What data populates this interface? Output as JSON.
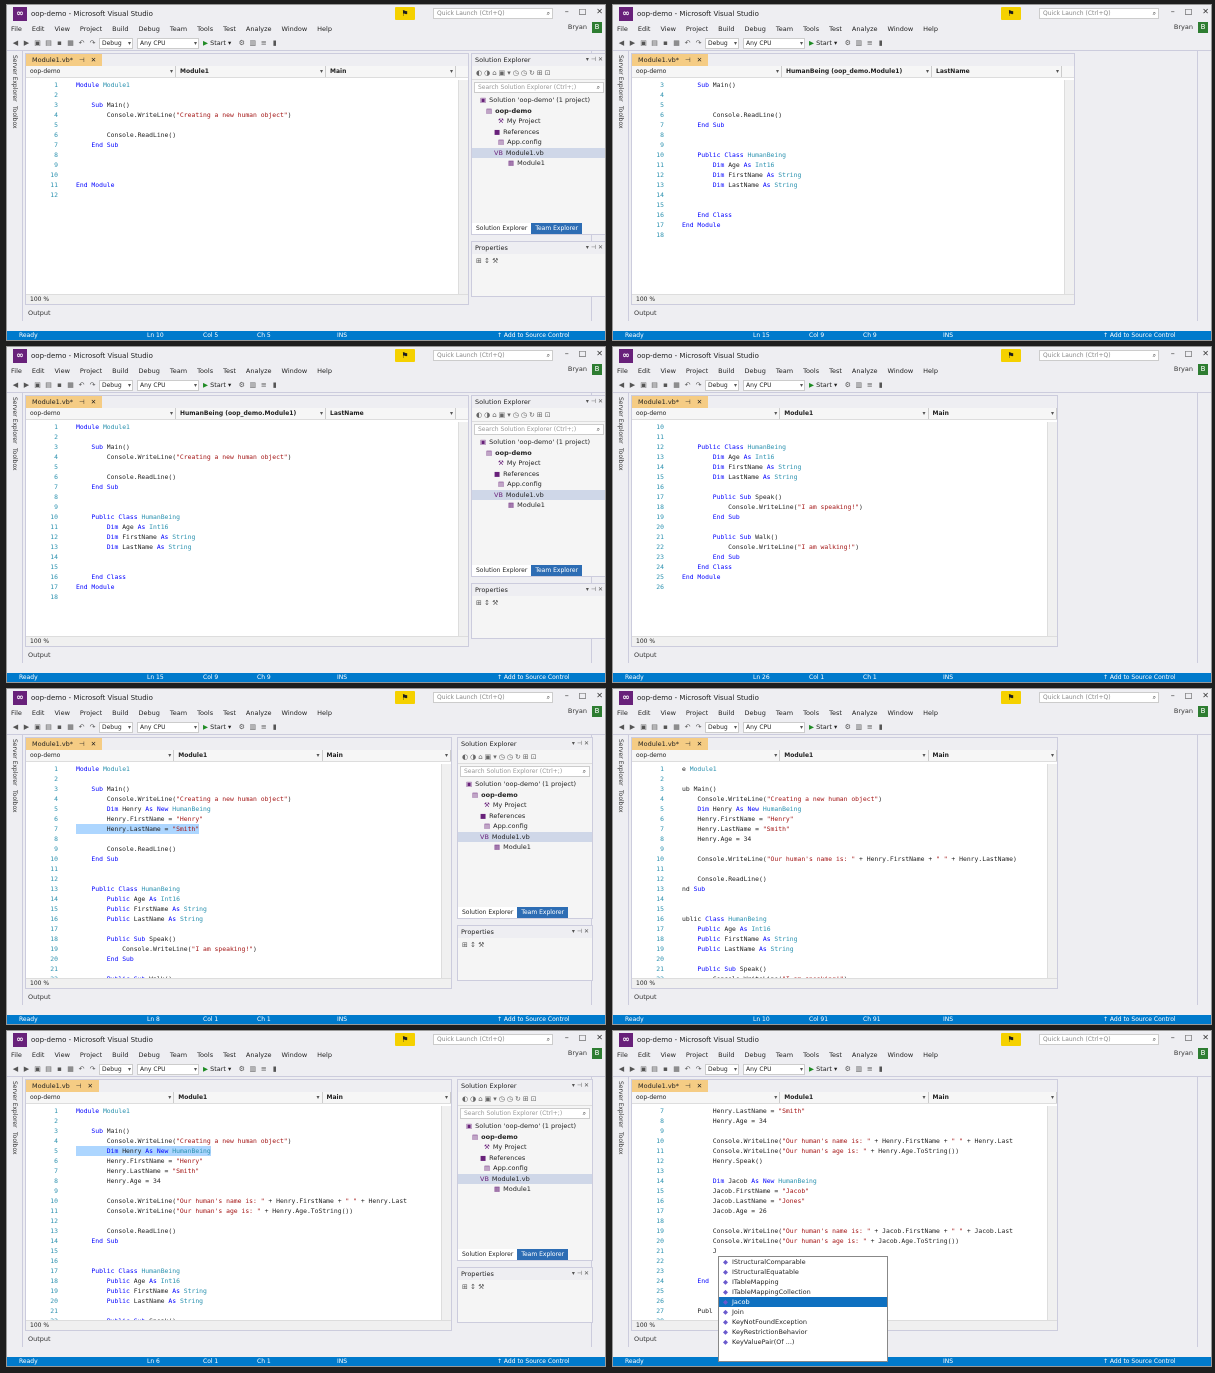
{
  "common": {
    "window_title": "oop-demo - Microsoft Visual Studio",
    "quick_launch_placeholder": "Quick Launch (Ctrl+Q)",
    "user": "Bryan",
    "user_badge": "B",
    "menu": [
      "File",
      "Edit",
      "View",
      "Project",
      "Build",
      "Debug",
      "Team",
      "Tools",
      "Test",
      "Analyze",
      "Window",
      "Help"
    ],
    "config": "Debug",
    "platform": "Any CPU",
    "start_label": "Start",
    "solution_explorer_title": "Solution Explorer",
    "search_placeholder": "Search Solution Explorer (Ctrl+;)",
    "tree": [
      "Solution 'oop-demo' (1 project)",
      "oop-demo",
      "My Project",
      "References",
      "App.config",
      "Module1.vb",
      "Module1"
    ],
    "tab_solution_explorer": "Solution Explorer",
    "tab_team_explorer": "Team Explorer",
    "properties_title": "Properties",
    "output_label": "Output",
    "zoom": "100 %",
    "status_ready": "Ready",
    "status_ins": "INS",
    "status_source": "↑ Add to Source Control",
    "side_server": "Server Explorer",
    "side_toolbox": "Toolbox",
    "side_diag": "Diagnostic Tools"
  },
  "panels": [
    {
      "doc_tab": "Module1.vb*",
      "nav": [
        "oop-demo",
        "Module1",
        "Main"
      ],
      "status": {
        "ln": "Ln 10",
        "col": "Col 5",
        "ch": "Ch 5"
      },
      "lines": [
        {
          "n": "1",
          "t": "Module Module1"
        },
        {
          "n": "2",
          "t": ""
        },
        {
          "n": "3",
          "t": "    Sub Main()"
        },
        {
          "n": "4",
          "t": "        Console.WriteLine(\"Creating a new human object\")"
        },
        {
          "n": "5",
          "t": ""
        },
        {
          "n": "6",
          "t": "        Console.ReadLine()"
        },
        {
          "n": "7",
          "t": "    End Sub"
        },
        {
          "n": "8",
          "t": ""
        },
        {
          "n": "9",
          "t": ""
        },
        {
          "n": "10",
          "t": ""
        },
        {
          "n": "11",
          "t": "End Module"
        },
        {
          "n": "12",
          "t": ""
        }
      ]
    },
    {
      "doc_tab": "Module1.vb*",
      "nav": [
        "oop-demo",
        "HumanBeing (oop_demo.Module1)",
        "LastName"
      ],
      "status": {
        "ln": "Ln 15",
        "col": "Col 9",
        "ch": "Ch 9"
      },
      "lines": [
        {
          "n": "3",
          "t": "    Sub Main()"
        },
        {
          "n": "4",
          "t": ""
        },
        {
          "n": "5",
          "t": ""
        },
        {
          "n": "6",
          "t": "        Console.ReadLine()"
        },
        {
          "n": "7",
          "t": "    End Sub"
        },
        {
          "n": "8",
          "t": ""
        },
        {
          "n": "9",
          "t": ""
        },
        {
          "n": "10",
          "t": "    Public Class HumanBeing"
        },
        {
          "n": "11",
          "t": "        Dim Age As Int16"
        },
        {
          "n": "12",
          "t": "        Dim FirstName As String"
        },
        {
          "n": "13",
          "t": "        Dim LastName As String"
        },
        {
          "n": "14",
          "t": ""
        },
        {
          "n": "15",
          "t": ""
        },
        {
          "n": "16",
          "t": "    End Class"
        },
        {
          "n": "17",
          "t": "End Module"
        },
        {
          "n": "18",
          "t": ""
        }
      ]
    },
    {
      "doc_tab": "Module1.vb*",
      "nav": [
        "oop-demo",
        "HumanBeing (oop_demo.Module1)",
        "LastName"
      ],
      "status": {
        "ln": "Ln 15",
        "col": "Col 9",
        "ch": "Ch 9"
      },
      "lines": [
        {
          "n": "1",
          "t": "Module Module1"
        },
        {
          "n": "2",
          "t": ""
        },
        {
          "n": "3",
          "t": "    Sub Main()"
        },
        {
          "n": "4",
          "t": "        Console.WriteLine(\"Creating a new human object\")"
        },
        {
          "n": "5",
          "t": ""
        },
        {
          "n": "6",
          "t": "        Console.ReadLine()"
        },
        {
          "n": "7",
          "t": "    End Sub"
        },
        {
          "n": "8",
          "t": ""
        },
        {
          "n": "9",
          "t": ""
        },
        {
          "n": "10",
          "t": "    Public Class HumanBeing"
        },
        {
          "n": "11",
          "t": "        Dim Age As Int16"
        },
        {
          "n": "12",
          "t": "        Dim FirstName As String"
        },
        {
          "n": "13",
          "t": "        Dim LastName As String"
        },
        {
          "n": "14",
          "t": ""
        },
        {
          "n": "15",
          "t": ""
        },
        {
          "n": "16",
          "t": "    End Class"
        },
        {
          "n": "17",
          "t": "End Module"
        },
        {
          "n": "18",
          "t": ""
        }
      ]
    },
    {
      "doc_tab": "Module1.vb*",
      "nav": [
        "oop-demo",
        "Module1",
        "Main"
      ],
      "status": {
        "ln": "Ln 26",
        "col": "Col 1",
        "ch": "Ch 1"
      },
      "lines": [
        {
          "n": "10",
          "t": ""
        },
        {
          "n": "11",
          "t": ""
        },
        {
          "n": "12",
          "t": "    Public Class HumanBeing"
        },
        {
          "n": "13",
          "t": "        Dim Age As Int16"
        },
        {
          "n": "14",
          "t": "        Dim FirstName As String"
        },
        {
          "n": "15",
          "t": "        Dim LastName As String"
        },
        {
          "n": "16",
          "t": ""
        },
        {
          "n": "17",
          "t": "        Public Sub Speak()"
        },
        {
          "n": "18",
          "t": "            Console.WriteLine(\"I am speaking!\")"
        },
        {
          "n": "19",
          "t": "        End Sub"
        },
        {
          "n": "20",
          "t": ""
        },
        {
          "n": "21",
          "t": "        Public Sub Walk()"
        },
        {
          "n": "22",
          "t": "            Console.WriteLine(\"I am walking!\")"
        },
        {
          "n": "23",
          "t": "        End Sub"
        },
        {
          "n": "24",
          "t": "    End Class"
        },
        {
          "n": "25",
          "t": "End Module"
        },
        {
          "n": "26",
          "t": ""
        }
      ]
    },
    {
      "doc_tab": "Module1.vb*",
      "nav": [
        "oop-demo",
        "Module1",
        "Main"
      ],
      "status": {
        "ln": "Ln 8",
        "col": "Col 1",
        "ch": "Ch 1"
      },
      "lines": [
        {
          "n": "1",
          "t": "Module Module1"
        },
        {
          "n": "2",
          "t": ""
        },
        {
          "n": "3",
          "t": "    Sub Main()"
        },
        {
          "n": "4",
          "t": "        Console.WriteLine(\"Creating a new human object\")"
        },
        {
          "n": "5",
          "t": "        Dim Henry As New HumanBeing"
        },
        {
          "n": "6",
          "t": "        Henry.FirstName = \"Henry\""
        },
        {
          "n": "7",
          "t": "        Henry.LastName = \"Smith\"",
          "hl": true
        },
        {
          "n": "8",
          "t": ""
        },
        {
          "n": "9",
          "t": "        Console.ReadLine()"
        },
        {
          "n": "10",
          "t": "    End Sub"
        },
        {
          "n": "11",
          "t": ""
        },
        {
          "n": "12",
          "t": ""
        },
        {
          "n": "13",
          "t": "    Public Class HumanBeing"
        },
        {
          "n": "14",
          "t": "        Public Age As Int16"
        },
        {
          "n": "15",
          "t": "        Public FirstName As String"
        },
        {
          "n": "16",
          "t": "        Public LastName As String"
        },
        {
          "n": "17",
          "t": ""
        },
        {
          "n": "18",
          "t": "        Public Sub Speak()"
        },
        {
          "n": "19",
          "t": "            Console.WriteLine(\"I am speaking!\")"
        },
        {
          "n": "20",
          "t": "        End Sub"
        },
        {
          "n": "21",
          "t": ""
        },
        {
          "n": "22",
          "t": "        Public Sub Walk()"
        }
      ]
    },
    {
      "doc_tab": "Module1.vb*",
      "nav": [
        "oop-demo",
        "Module1",
        "Main"
      ],
      "status": {
        "ln": "Ln 10",
        "col": "Col 91",
        "ch": "Ch 91"
      },
      "lines": [
        {
          "n": "1",
          "t": "e Module1"
        },
        {
          "n": "2",
          "t": ""
        },
        {
          "n": "3",
          "t": "ub Main()"
        },
        {
          "n": "4",
          "t": "    Console.WriteLine(\"Creating a new human object\")"
        },
        {
          "n": "5",
          "t": "    Dim Henry As New HumanBeing"
        },
        {
          "n": "6",
          "t": "    Henry.FirstName = \"Henry\""
        },
        {
          "n": "7",
          "t": "    Henry.LastName = \"Smith\""
        },
        {
          "n": "8",
          "t": "    Henry.Age = 34"
        },
        {
          "n": "9",
          "t": ""
        },
        {
          "n": "10",
          "t": "    Console.WriteLine(\"Our human's name is: \" + Henry.FirstName + \" \" + Henry.LastName)"
        },
        {
          "n": "11",
          "t": ""
        },
        {
          "n": "12",
          "t": "    Console.ReadLine()"
        },
        {
          "n": "13",
          "t": "nd Sub"
        },
        {
          "n": "14",
          "t": ""
        },
        {
          "n": "15",
          "t": ""
        },
        {
          "n": "16",
          "t": "ublic Class HumanBeing"
        },
        {
          "n": "17",
          "t": "    Public Age As Int16"
        },
        {
          "n": "18",
          "t": "    Public FirstName As String"
        },
        {
          "n": "19",
          "t": "    Public LastName As String"
        },
        {
          "n": "20",
          "t": ""
        },
        {
          "n": "21",
          "t": "    Public Sub Speak()"
        },
        {
          "n": "22",
          "t": "        Console.WriteLine(\"I am speaking!\")"
        }
      ]
    },
    {
      "doc_tab": "Module1.vb",
      "nav": [
        "oop-demo",
        "Module1",
        "Main"
      ],
      "status": {
        "ln": "Ln 6",
        "col": "Col 1",
        "ch": "Ch 1"
      },
      "lines": [
        {
          "n": "1",
          "t": "Module Module1"
        },
        {
          "n": "2",
          "t": ""
        },
        {
          "n": "3",
          "t": "    Sub Main()"
        },
        {
          "n": "4",
          "t": "        Console.WriteLine(\"Creating a new human object\")"
        },
        {
          "n": "5",
          "t": "        Dim Henry As New HumanBeing",
          "hl": true
        },
        {
          "n": "6",
          "t": "        Henry.FirstName = \"Henry\""
        },
        {
          "n": "7",
          "t": "        Henry.LastName = \"Smith\""
        },
        {
          "n": "8",
          "t": "        Henry.Age = 34"
        },
        {
          "n": "9",
          "t": ""
        },
        {
          "n": "10",
          "t": "        Console.WriteLine(\"Our human's name is: \" + Henry.FirstName + \" \" + Henry.Last"
        },
        {
          "n": "11",
          "t": "        Console.WriteLine(\"Our human's age is: \" + Henry.Age.ToString())"
        },
        {
          "n": "12",
          "t": ""
        },
        {
          "n": "13",
          "t": "        Console.ReadLine()"
        },
        {
          "n": "14",
          "t": "    End Sub"
        },
        {
          "n": "15",
          "t": ""
        },
        {
          "n": "16",
          "t": ""
        },
        {
          "n": "17",
          "t": "    Public Class HumanBeing"
        },
        {
          "n": "18",
          "t": "        Public Age As Int16"
        },
        {
          "n": "19",
          "t": "        Public FirstName As String"
        },
        {
          "n": "20",
          "t": "        Public LastName As String"
        },
        {
          "n": "21",
          "t": ""
        },
        {
          "n": "22",
          "t": "        Public Sub Speak()"
        }
      ]
    },
    {
      "doc_tab": "Module1.vb*",
      "nav": [
        "oop-demo",
        "Module1",
        "Main"
      ],
      "status": {
        "ln": "",
        "col": "",
        "ch": ""
      },
      "lines": [
        {
          "n": "7",
          "t": "        Henry.LastName = \"Smith\""
        },
        {
          "n": "8",
          "t": "        Henry.Age = 34"
        },
        {
          "n": "9",
          "t": ""
        },
        {
          "n": "10",
          "t": "        Console.WriteLine(\"Our human's name is: \" + Henry.FirstName + \" \" + Henry.Last"
        },
        {
          "n": "11",
          "t": "        Console.WriteLine(\"Our human's age is: \" + Henry.Age.ToString())"
        },
        {
          "n": "12",
          "t": "        Henry.Speak()"
        },
        {
          "n": "13",
          "t": ""
        },
        {
          "n": "14",
          "t": "        Dim Jacob As New HumanBeing"
        },
        {
          "n": "15",
          "t": "        Jacob.FirstName = \"Jacob\""
        },
        {
          "n": "16",
          "t": "        Jacob.LastName = \"Jones\""
        },
        {
          "n": "17",
          "t": "        Jacob.Age = 26"
        },
        {
          "n": "18",
          "t": ""
        },
        {
          "n": "19",
          "t": "        Console.WriteLine(\"Our human's name is: \" + Jacob.FirstName + \" \" + Jacob.Last"
        },
        {
          "n": "20",
          "t": "        Console.WriteLine(\"Our human's age is: \" + Jacob.Age.ToString())"
        },
        {
          "n": "21",
          "t": "        J"
        },
        {
          "n": "22",
          "t": ""
        },
        {
          "n": "23",
          "t": ""
        },
        {
          "n": "24",
          "t": "    End"
        },
        {
          "n": "25",
          "t": ""
        },
        {
          "n": "26",
          "t": ""
        },
        {
          "n": "27",
          "t": "    Publ"
        },
        {
          "n": "28",
          "t": ""
        }
      ]
    }
  ],
  "autocomplete": [
    "IStructuralComparable",
    "IStructuralEquatable",
    "ITableMapping",
    "ITableMappingCollection",
    "Jacob",
    "Join",
    "KeyNotFoundException",
    "KeyRestrictionBehavior",
    "KeyValuePair(Of ...)"
  ],
  "autocomplete_selected": "Jacob"
}
